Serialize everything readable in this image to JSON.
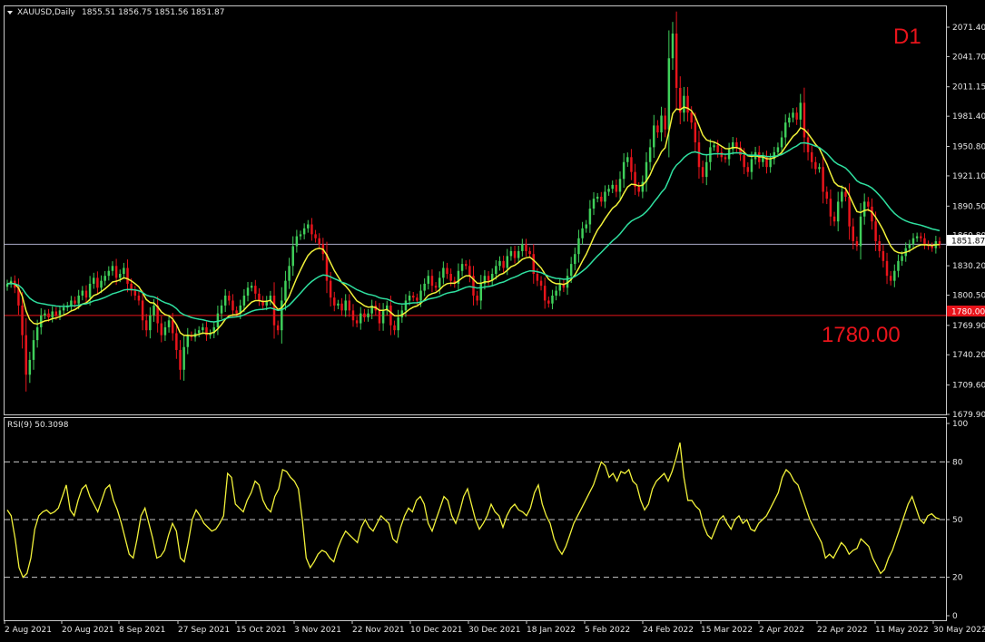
{
  "header": {
    "symbol": "XAUUSD,Daily",
    "ohlc": "1855.51 1856.75 1851.56 1851.87",
    "rsi_label": "RSI(9) 50.3098"
  },
  "annotations": {
    "timeframe": "D1",
    "level_label": "1780.00"
  },
  "colors": {
    "background": "#000000",
    "bull": "#3fcf5a",
    "bear": "#e8141b",
    "ma_fast": "#f2f23a",
    "ma_slow": "#2fe0a0",
    "rsi": "#f2f23a",
    "level": "#e8141b",
    "grid": "#c8c8c8",
    "accent_red": "#e8141b"
  },
  "chart_data": [
    {
      "type": "candlestick",
      "title": "XAUUSD,Daily",
      "ylim": [
        1679.9,
        2080
      ],
      "y_ticks": [
        "2071.40",
        "2041.70",
        "2011.15",
        "1981.40",
        "1950.80",
        "1921.10",
        "1890.50",
        "1860.80",
        "1830.20",
        "1800.50",
        "1769.90",
        "1740.20",
        "1709.60",
        "1679.90"
      ],
      "x_ticks": [
        "2 Aug 2021",
        "20 Aug 2021",
        "8 Sep 2021",
        "27 Sep 2021",
        "15 Oct 2021",
        "3 Nov 2021",
        "22 Nov 2021",
        "10 Dec 2021",
        "30 Dec 2021",
        "18 Jan 2022",
        "5 Feb 2022",
        "24 Feb 2022",
        "15 Mar 2022",
        "2 Apr 2022",
        "22 Apr 2022",
        "11 May 2022",
        "30 May 2022"
      ],
      "current_price": "1851.87",
      "level_marker": "1780.00",
      "close": [
        1812,
        1815,
        1808,
        1790,
        1760,
        1720,
        1735,
        1755,
        1768,
        1780,
        1782,
        1778,
        1784,
        1780,
        1785,
        1788,
        1790,
        1795,
        1792,
        1800,
        1805,
        1798,
        1812,
        1818,
        1808,
        1815,
        1820,
        1825,
        1830,
        1818,
        1822,
        1828,
        1812,
        1805,
        1800,
        1795,
        1775,
        1765,
        1780,
        1790,
        1772,
        1760,
        1768,
        1775,
        1762,
        1745,
        1725,
        1748,
        1760,
        1758,
        1762,
        1765,
        1768,
        1760,
        1762,
        1768,
        1782,
        1790,
        1800,
        1795,
        1785,
        1782,
        1790,
        1800,
        1808,
        1810,
        1802,
        1795,
        1790,
        1795,
        1800,
        1770,
        1765,
        1795,
        1815,
        1830,
        1850,
        1860,
        1862,
        1868,
        1872,
        1862,
        1858,
        1852,
        1842,
        1815,
        1798,
        1790,
        1792,
        1785,
        1795,
        1785,
        1775,
        1772,
        1782,
        1778,
        1782,
        1790,
        1785,
        1772,
        1785,
        1790,
        1770,
        1765,
        1778,
        1785,
        1795,
        1800,
        1798,
        1795,
        1805,
        1812,
        1820,
        1810,
        1808,
        1818,
        1828,
        1822,
        1815,
        1812,
        1825,
        1832,
        1830,
        1820,
        1800,
        1795,
        1812,
        1820,
        1815,
        1822,
        1830,
        1835,
        1828,
        1840,
        1845,
        1838,
        1845,
        1852,
        1845,
        1842,
        1822,
        1815,
        1810,
        1795,
        1792,
        1800,
        1805,
        1812,
        1808,
        1820,
        1832,
        1842,
        1858,
        1868,
        1872,
        1888,
        1898,
        1900,
        1895,
        1905,
        1908,
        1912,
        1905,
        1918,
        1935,
        1940,
        1925,
        1910,
        1905,
        1915,
        1935,
        1950,
        1972,
        1965,
        1982,
        1968,
        2040,
        2065,
        2010,
        1985,
        2002,
        1985,
        1975,
        1955,
        1930,
        1920,
        1935,
        1950,
        1952,
        1945,
        1940,
        1938,
        1948,
        1955,
        1950,
        1942,
        1930,
        1925,
        1938,
        1945,
        1935,
        1940,
        1930,
        1938,
        1945,
        1950,
        1960,
        1975,
        1980,
        1985,
        1978,
        1995,
        1960,
        1945,
        1935,
        1928,
        1930,
        1905,
        1898,
        1880,
        1875,
        1895,
        1905,
        1900,
        1870,
        1855,
        1850,
        1880,
        1895,
        1890,
        1875,
        1855,
        1845,
        1835,
        1820,
        1815,
        1825,
        1835,
        1840,
        1848,
        1852,
        1858,
        1860,
        1858,
        1852,
        1850,
        1848,
        1855,
        1851.87
      ]
    },
    {
      "type": "line",
      "title": "RSI(9) 50.3098",
      "ylim": [
        0,
        100
      ],
      "y_ticks": [
        "100",
        "80",
        "50",
        "20",
        "0"
      ],
      "levels": [
        80,
        50,
        20
      ],
      "values": [
        55,
        52,
        40,
        25,
        20,
        22,
        30,
        45,
        52,
        54,
        55,
        53,
        54,
        56,
        62,
        68,
        55,
        52,
        60,
        66,
        68,
        62,
        58,
        54,
        60,
        66,
        68,
        60,
        55,
        48,
        40,
        32,
        30,
        40,
        52,
        56,
        48,
        40,
        30,
        31,
        34,
        42,
        48,
        44,
        30,
        28,
        38,
        50,
        55,
        52,
        48,
        46,
        44,
        45,
        48,
        52,
        74,
        72,
        58,
        56,
        54,
        60,
        64,
        70,
        68,
        60,
        56,
        54,
        62,
        66,
        76,
        75,
        72,
        70,
        66,
        50,
        30,
        25,
        28,
        32,
        34,
        33,
        30,
        28,
        35,
        40,
        44,
        42,
        40,
        38,
        46,
        50,
        46,
        44,
        48,
        52,
        50,
        48,
        40,
        38,
        46,
        52,
        56,
        54,
        60,
        62,
        58,
        48,
        44,
        50,
        56,
        62,
        60,
        52,
        48,
        54,
        62,
        66,
        58,
        50,
        45,
        48,
        52,
        58,
        54,
        52,
        46,
        52,
        56,
        58,
        55,
        54,
        52,
        56,
        64,
        68,
        58,
        52,
        48,
        40,
        35,
        32,
        36,
        42,
        48,
        52,
        56,
        60,
        64,
        68,
        74,
        80,
        78,
        72,
        74,
        70,
        75,
        74,
        76,
        70,
        68,
        60,
        55,
        58,
        66,
        70,
        72,
        74,
        70,
        75,
        82,
        90,
        72,
        60,
        60,
        57,
        55,
        47,
        42,
        40,
        45,
        50,
        52,
        48,
        45,
        50,
        52,
        48,
        50,
        45,
        44,
        48,
        50,
        52,
        56,
        60,
        64,
        72,
        76,
        74,
        70,
        68,
        62,
        56,
        50,
        46,
        42,
        38,
        30,
        32,
        30,
        34,
        38,
        36,
        32,
        34,
        35,
        40,
        38,
        36,
        30,
        26,
        22,
        24,
        30,
        34,
        40,
        46,
        52,
        58,
        62,
        56,
        50,
        48,
        52,
        53,
        51,
        50.3
      ]
    }
  ]
}
